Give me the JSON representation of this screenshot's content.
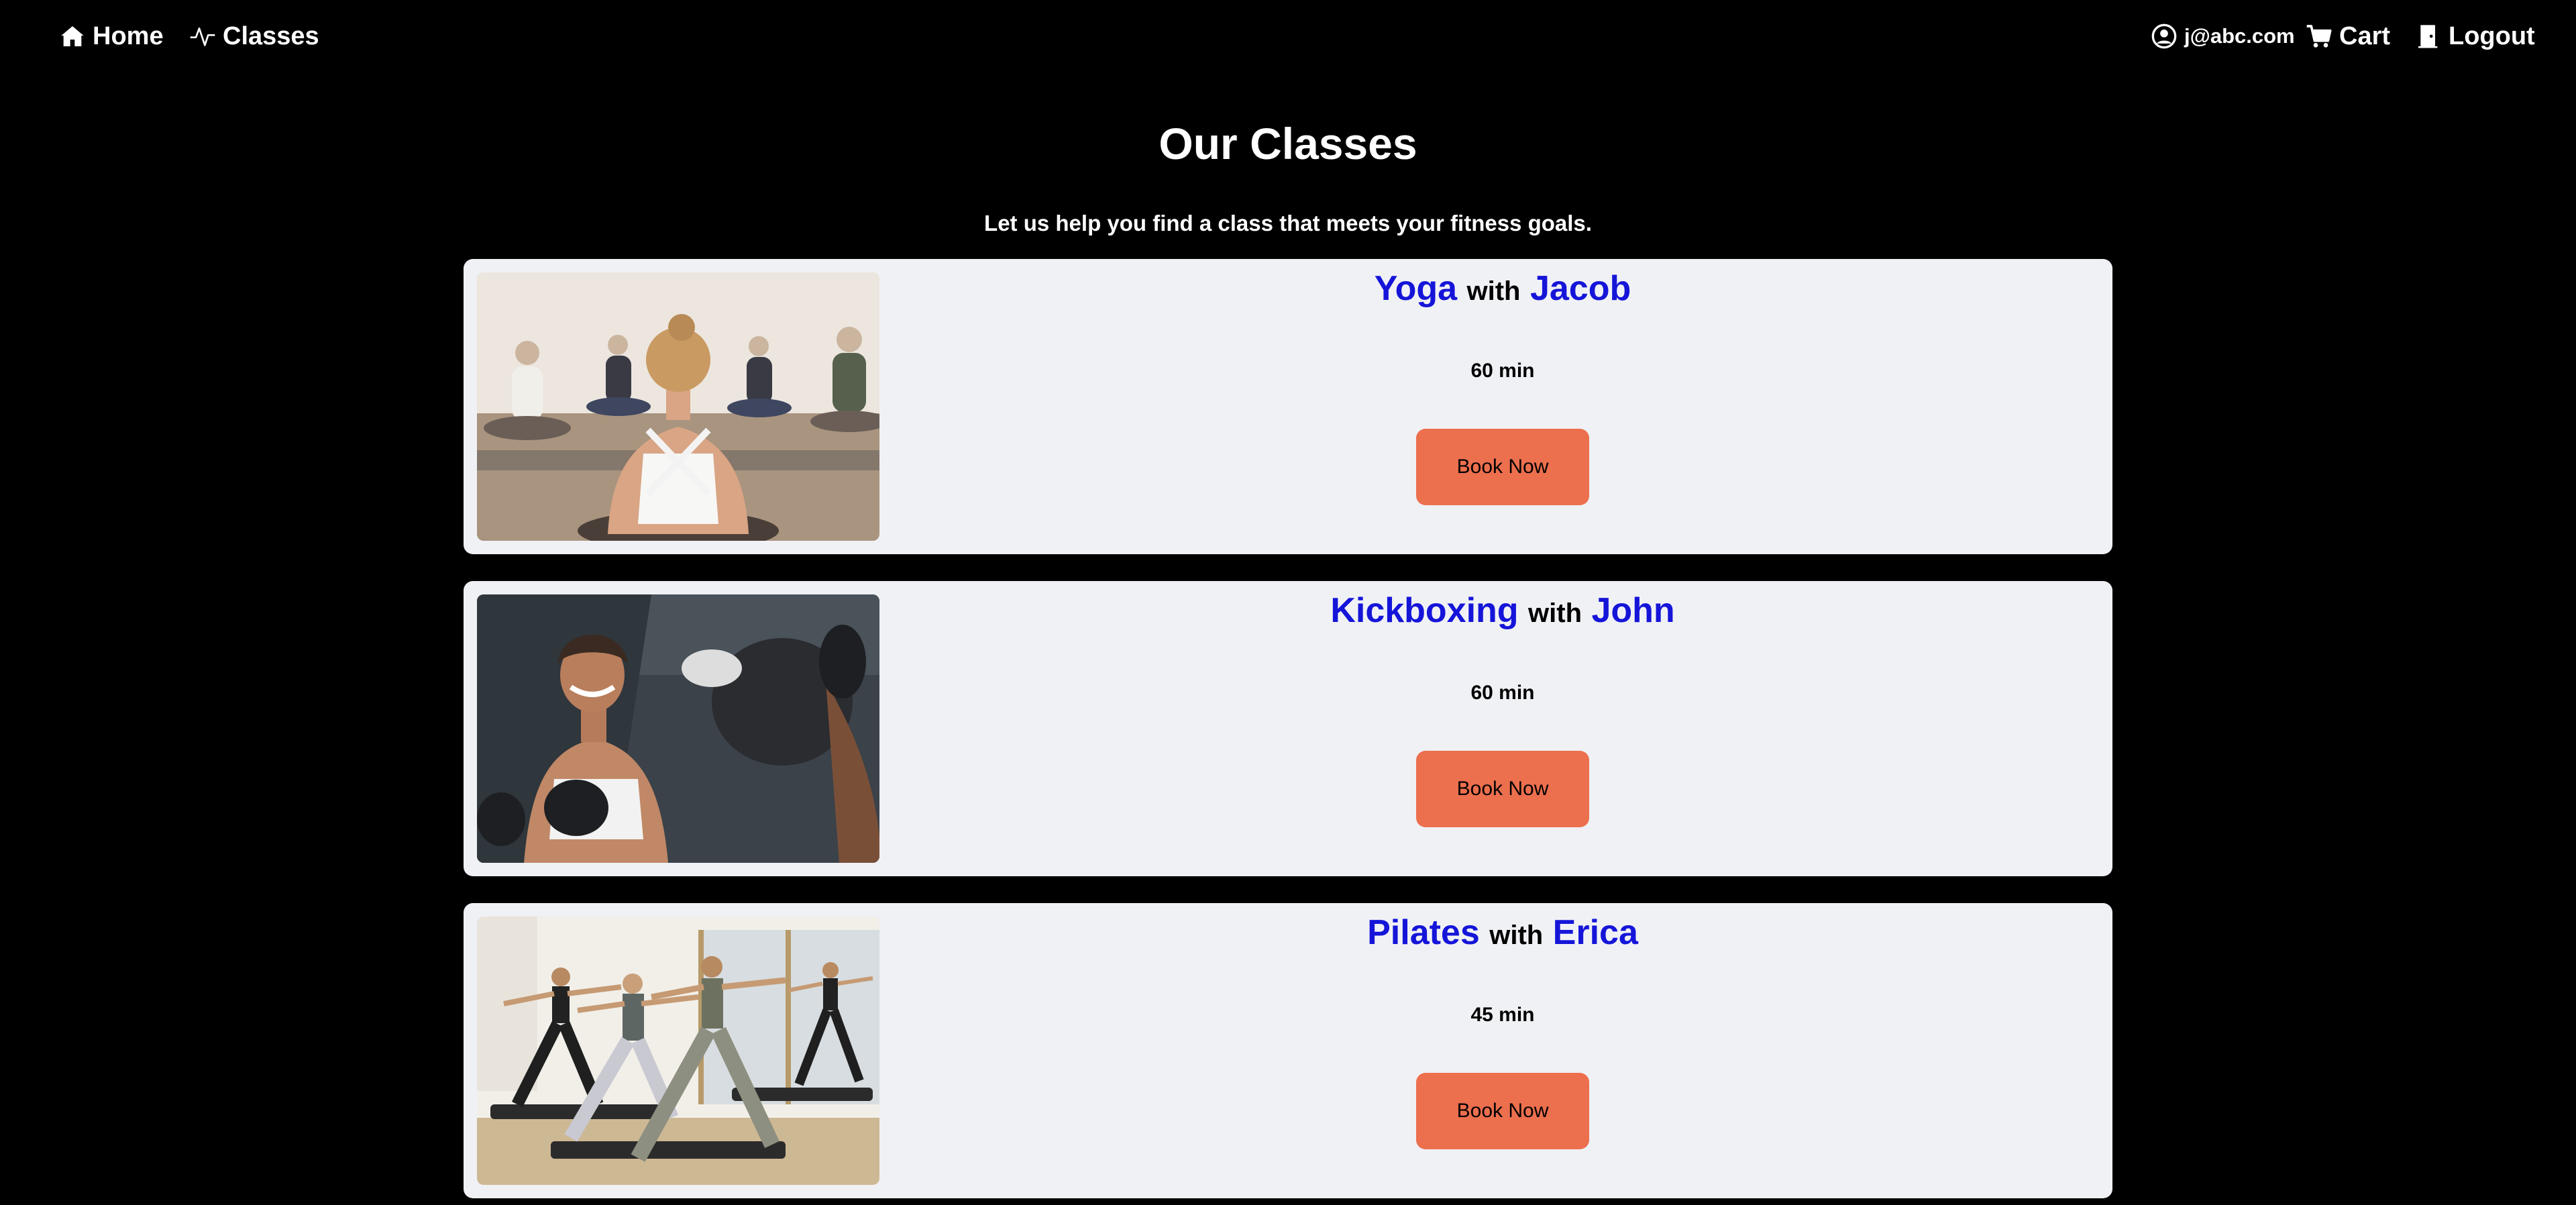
{
  "nav": {
    "home_label": "Home",
    "classes_label": "Classes",
    "user_label": "j@abc.com",
    "cart_label": "Cart",
    "logout_label": "Logout"
  },
  "page": {
    "title": "Our Classes",
    "subtitle": "Let us help you find a class that meets your fitness goals."
  },
  "classes": [
    {
      "name": "Yoga",
      "with": "with",
      "instructor": "Jacob",
      "duration": "60 min",
      "button": "Book Now",
      "image": "yoga-class-photo"
    },
    {
      "name": "Kickboxing",
      "with": "with",
      "instructor": "John",
      "duration": "60 min",
      "button": "Book Now",
      "image": "kickboxing-class-photo"
    },
    {
      "name": "Pilates",
      "with": "with",
      "instructor": "Erica",
      "duration": "45 min",
      "button": "Book Now",
      "image": "pilates-class-photo"
    }
  ],
  "colors": {
    "background": "#000000",
    "card": "#f0f1f5",
    "accent_text": "#1515d9",
    "button": "#ec6f4e"
  }
}
